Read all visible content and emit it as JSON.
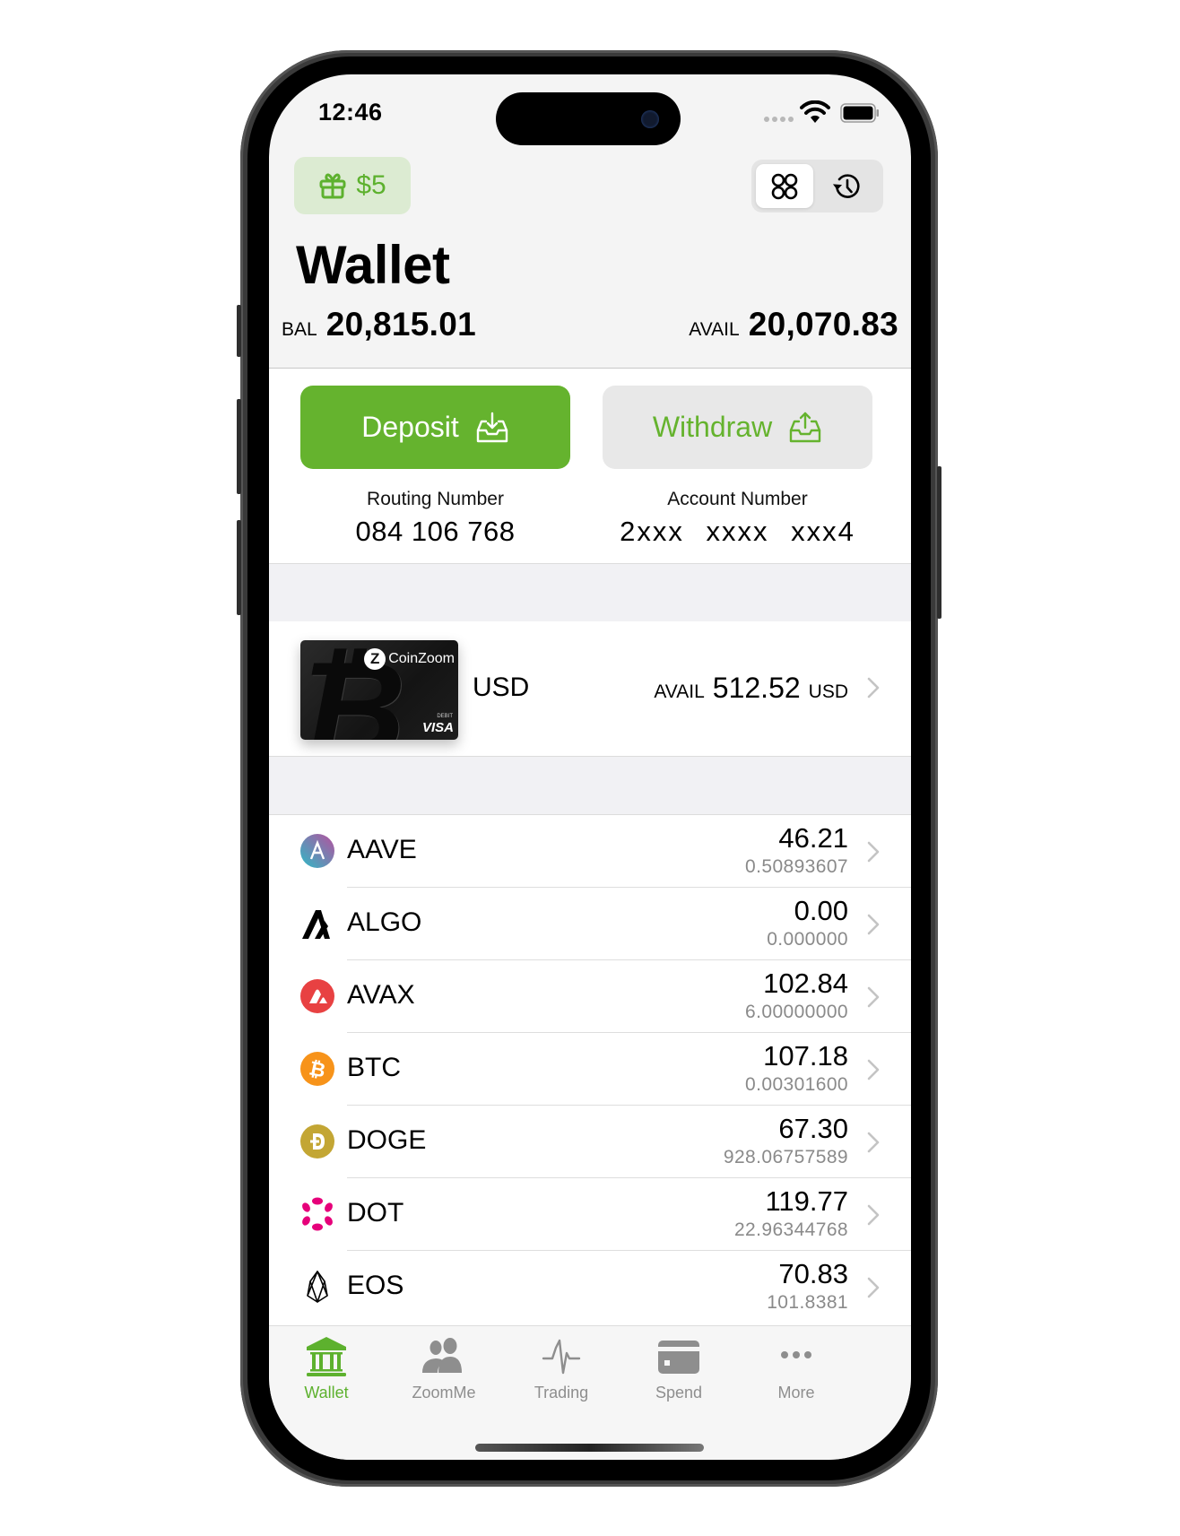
{
  "status_bar": {
    "time": "12:46"
  },
  "header": {
    "gift_badge": {
      "icon": "gift-icon",
      "label": "$5",
      "color": "#5db12e"
    },
    "view_toggle": [
      {
        "icon": "grid-icon",
        "selected": true
      },
      {
        "icon": "history-icon",
        "selected": false
      }
    ],
    "title": "Wallet",
    "balance": {
      "label": "BAL",
      "value": "20,815.01"
    },
    "available": {
      "label": "AVAIL",
      "value": "20,070.83"
    }
  },
  "actions": {
    "deposit": {
      "label": "Deposit",
      "icon": "tray-download-icon",
      "color": "#65b32e"
    },
    "withdraw": {
      "label": "Withdraw",
      "icon": "tray-upload-icon"
    }
  },
  "bank_info": {
    "routing": {
      "label": "Routing Number",
      "value": "084 106 768"
    },
    "account": {
      "label": "Account Number",
      "value": "2xxx xxxx xxx4"
    }
  },
  "card": {
    "brand": "CoinZoom",
    "type": "DEBIT",
    "network": "VISA",
    "currency": "USD",
    "avail_label": "AVAIL",
    "avail_value": "512.52",
    "avail_currency": "USD"
  },
  "assets": [
    {
      "symbol": "AAVE",
      "icon": "aave-icon",
      "usd_value": "46.21",
      "quantity": "0.50893607"
    },
    {
      "symbol": "ALGO",
      "icon": "algo-icon",
      "usd_value": "0.00",
      "quantity": "0.000000"
    },
    {
      "symbol": "AVAX",
      "icon": "avax-icon",
      "usd_value": "102.84",
      "quantity": "6.00000000"
    },
    {
      "symbol": "BTC",
      "icon": "btc-icon",
      "usd_value": "107.18",
      "quantity": "0.00301600"
    },
    {
      "symbol": "DOGE",
      "icon": "doge-icon",
      "usd_value": "67.30",
      "quantity": "928.06757589"
    },
    {
      "symbol": "DOT",
      "icon": "dot-icon",
      "usd_value": "119.77",
      "quantity": "22.96344768"
    },
    {
      "symbol": "EOS",
      "icon": "eos-icon",
      "usd_value": "70.83",
      "quantity": "101.8381"
    }
  ],
  "tab_bar": {
    "active_color": "#5db12e",
    "inactive_color": "#8e8e8e",
    "tabs": [
      {
        "label": "Wallet",
        "icon": "bank-icon",
        "active": true
      },
      {
        "label": "ZoomMe",
        "icon": "people-icon",
        "active": false
      },
      {
        "label": "Trading",
        "icon": "pulse-icon",
        "active": false
      },
      {
        "label": "Spend",
        "icon": "card-icon",
        "active": false
      },
      {
        "label": "More",
        "icon": "more-icon",
        "active": false
      }
    ]
  }
}
